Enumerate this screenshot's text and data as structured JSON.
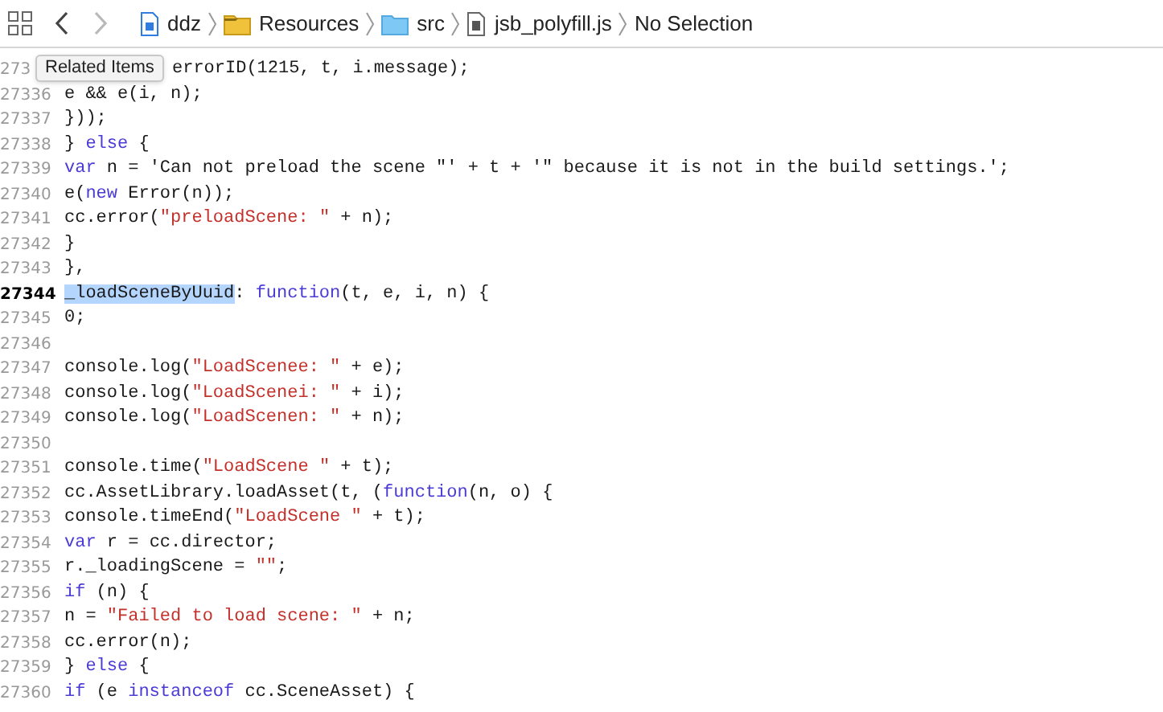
{
  "toolbar": {
    "nav": [
      {
        "kind": "back",
        "disabled": false
      },
      {
        "kind": "forward",
        "disabled": true
      }
    ],
    "breadcrumb": [
      {
        "label": "ddz",
        "kind": "project"
      },
      {
        "label": "Resources",
        "kind": "folder"
      },
      {
        "label": "src",
        "kind": "blue_folder"
      },
      {
        "label": "jsb_polyfill.js",
        "kind": "file"
      },
      {
        "label": "No Selection",
        "kind": "none"
      }
    ]
  },
  "tooltip": {
    "text": "Related Items"
  },
  "editor": {
    "lines": [
      {
        "number": "273",
        "current": false,
        "tokens": [
          {
            "text": "errorID(1215, t, i.message);",
            "kind": "plain"
          }
        ]
      },
      {
        "number": "27336",
        "current": false,
        "tokens": [
          {
            "text": "e && e(i, n);",
            "kind": "plain"
          }
        ]
      },
      {
        "number": "27337",
        "current": false,
        "tokens": [
          {
            "text": "}));",
            "kind": "plain"
          }
        ]
      },
      {
        "number": "27338",
        "current": false,
        "tokens": [
          {
            "text": "} ",
            "kind": "plain"
          },
          {
            "text": "else",
            "kind": "keyword"
          },
          {
            "text": " {",
            "kind": "plain"
          }
        ]
      },
      {
        "number": "27339",
        "current": false,
        "tokens": [
          {
            "text": "var",
            "kind": "keyword"
          },
          {
            "text": " n = 'Can not preload the scene \"' + t + '\" because it is not in the build settings.';",
            "kind": "plain"
          }
        ]
      },
      {
        "number": "27340",
        "current": false,
        "tokens": [
          {
            "text": "e(",
            "kind": "plain"
          },
          {
            "text": "new",
            "kind": "keyword"
          },
          {
            "text": " Error(n));",
            "kind": "plain"
          }
        ]
      },
      {
        "number": "27341",
        "current": false,
        "tokens": [
          {
            "text": "cc.error(",
            "kind": "plain"
          },
          {
            "text": "\"preloadScene: \"",
            "kind": "string"
          },
          {
            "text": " + n);",
            "kind": "plain"
          }
        ]
      },
      {
        "number": "27342",
        "current": false,
        "tokens": [
          {
            "text": "}",
            "kind": "plain"
          }
        ]
      },
      {
        "number": "27343",
        "current": false,
        "tokens": [
          {
            "text": "},",
            "kind": "plain"
          }
        ]
      },
      {
        "number": "27344",
        "current": true,
        "tokens": [
          {
            "text": "_loadSceneByUuid",
            "kind": "selected"
          },
          {
            "text": ": ",
            "kind": "plain"
          },
          {
            "text": "function",
            "kind": "keyword"
          },
          {
            "text": "(t, e, i, n) {",
            "kind": "plain"
          }
        ]
      },
      {
        "number": "27345",
        "current": false,
        "tokens": [
          {
            "text": "0;",
            "kind": "plain"
          }
        ]
      },
      {
        "number": "27346",
        "current": false
      },
      {
        "number": "27347",
        "current": false,
        "tokens": [
          {
            "text": "console.log(",
            "kind": "plain"
          },
          {
            "text": "\"LoadScenee: \"",
            "kind": "string"
          },
          {
            "text": " + e);",
            "kind": "plain"
          }
        ]
      },
      {
        "number": "27348",
        "current": false,
        "tokens": [
          {
            "text": "console.log(",
            "kind": "plain"
          },
          {
            "text": "\"LoadScenei: \"",
            "kind": "string"
          },
          {
            "text": " + i);",
            "kind": "plain"
          }
        ]
      },
      {
        "number": "27349",
        "current": false,
        "tokens": [
          {
            "text": "console.log(",
            "kind": "plain"
          },
          {
            "text": "\"LoadScenen: \"",
            "kind": "string"
          },
          {
            "text": " + n);",
            "kind": "plain"
          }
        ]
      },
      {
        "number": "27350",
        "current": false
      },
      {
        "number": "27351",
        "current": false,
        "tokens": [
          {
            "text": "console.time(",
            "kind": "plain"
          },
          {
            "text": "\"LoadScene \"",
            "kind": "string"
          },
          {
            "text": " + t);",
            "kind": "plain"
          }
        ]
      },
      {
        "number": "27352",
        "current": false,
        "tokens": [
          {
            "text": "cc.AssetLibrary.loadAsset(t, (",
            "kind": "plain"
          },
          {
            "text": "function",
            "kind": "keyword"
          },
          {
            "text": "(n, o) {",
            "kind": "plain"
          }
        ]
      },
      {
        "number": "27353",
        "current": false,
        "tokens": [
          {
            "text": "console.timeEnd(",
            "kind": "plain"
          },
          {
            "text": "\"LoadScene \"",
            "kind": "string"
          },
          {
            "text": " + t);",
            "kind": "plain"
          }
        ]
      },
      {
        "number": "27354",
        "current": false,
        "tokens": [
          {
            "text": "var",
            "kind": "keyword"
          },
          {
            "text": " r = cc.director;",
            "kind": "plain"
          }
        ]
      },
      {
        "number": "27355",
        "current": false,
        "tokens": [
          {
            "text": "r._loadingScene = ",
            "kind": "plain"
          },
          {
            "text": "\"\"",
            "kind": "string"
          },
          {
            "text": ";",
            "kind": "plain"
          }
        ]
      },
      {
        "number": "27356",
        "current": false,
        "tokens": [
          {
            "text": "if",
            "kind": "keyword"
          },
          {
            "text": " (n) {",
            "kind": "plain"
          }
        ]
      },
      {
        "number": "27357",
        "current": false,
        "tokens": [
          {
            "text": "n = ",
            "kind": "plain"
          },
          {
            "text": "\"Failed to load scene: \"",
            "kind": "string"
          },
          {
            "text": " + n;",
            "kind": "plain"
          }
        ]
      },
      {
        "number": "27358",
        "current": false,
        "tokens": [
          {
            "text": "cc.error(n);",
            "kind": "plain"
          }
        ]
      },
      {
        "number": "27359",
        "current": false,
        "tokens": [
          {
            "text": "} ",
            "kind": "plain"
          },
          {
            "text": "else",
            "kind": "keyword"
          },
          {
            "text": " {",
            "kind": "plain"
          }
        ]
      },
      {
        "number": "27360",
        "current": false,
        "tokens": [
          {
            "text": "if",
            "kind": "keyword"
          },
          {
            "text": " (e ",
            "kind": "plain"
          },
          {
            "text": "instanceof",
            "kind": "keyword"
          },
          {
            "text": " cc.SceneAsset) {",
            "kind": "plain"
          }
        ]
      }
    ]
  }
}
